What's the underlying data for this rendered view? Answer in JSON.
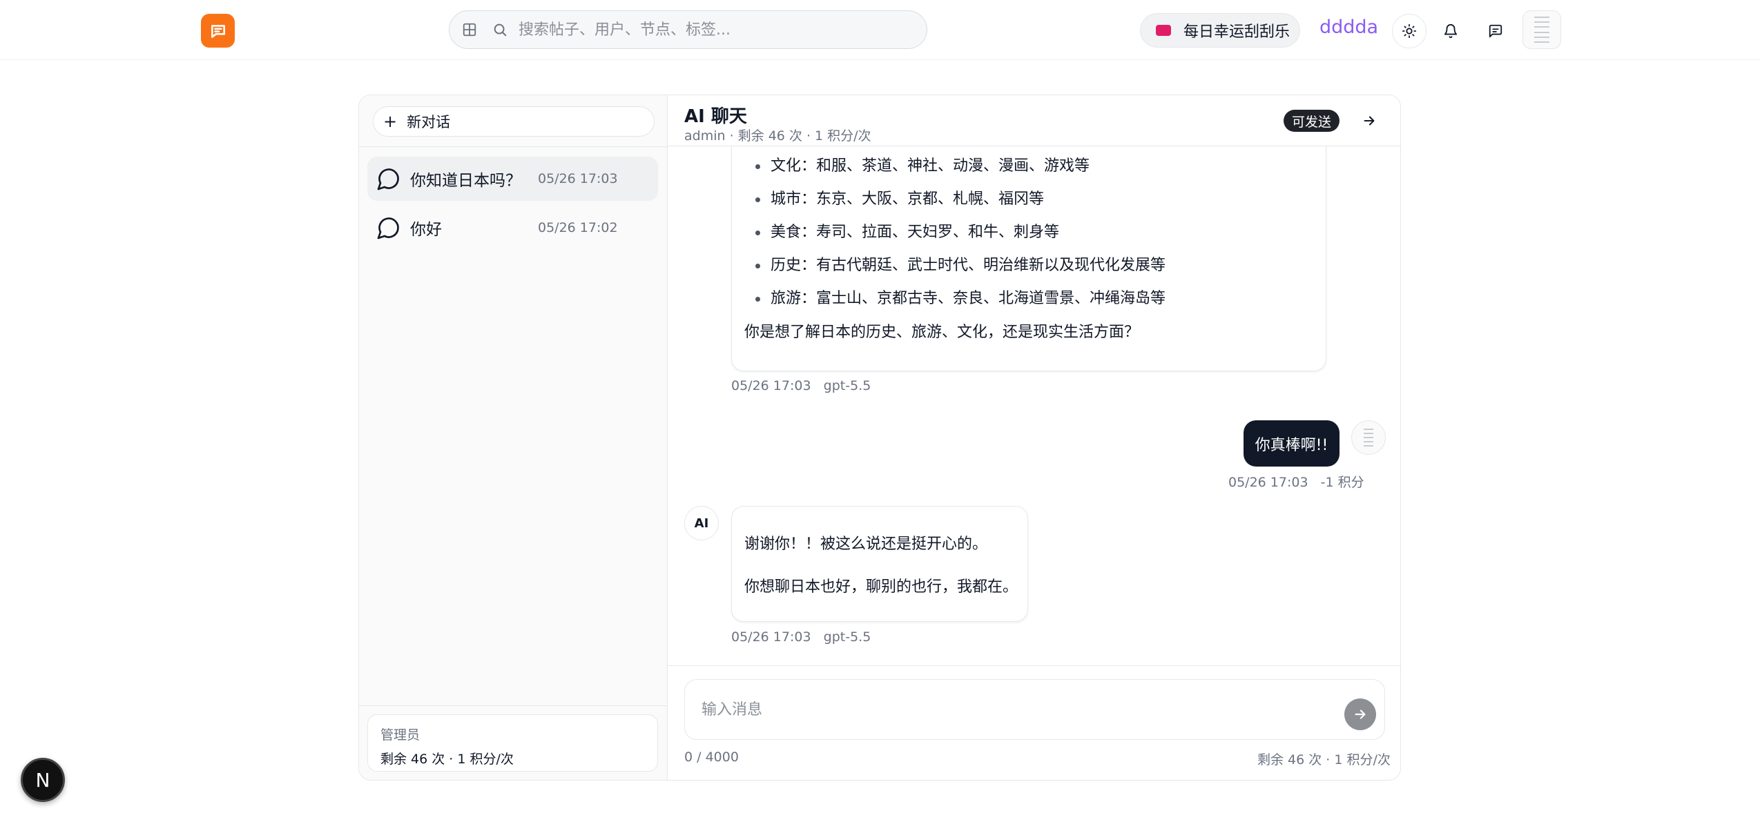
{
  "header": {
    "search_placeholder": "搜索帖子、用户、节点、标签...",
    "lucky_label": "每日幸运刮刮乐",
    "username": "dddda",
    "colors": {
      "logo": "#f97316",
      "username": "#8b5cf6",
      "lucky_ticket": "#e11d67"
    }
  },
  "sidebar": {
    "new_chat_label": "新对话",
    "conversations": [
      {
        "title": "你知道日本吗？",
        "time": "05/26 17:03",
        "active": true
      },
      {
        "title": "你好",
        "time": "05/26 17:02",
        "active": false
      }
    ],
    "footer": {
      "role": "管理员",
      "quota": "剩余 46 次 · 1 积分/次"
    }
  },
  "chat": {
    "title": "AI 聊天",
    "subtitle": "admin · 剩余 46 次 · 1 积分/次",
    "sendable_badge": "可发送",
    "messages": {
      "ai_1": {
        "bullets": [
          "文化：和服、茶道、神社、动漫、漫画、游戏等",
          "城市：东京、大阪、京都、札幌、福冈等",
          "美食：寿司、拉面、天妇罗、和牛、刺身等",
          "历史：有古代朝廷、武士时代、明治维新以及现代化发展等",
          "旅游：富士山、京都古寺、奈良、北海道雪景、冲绳海岛等"
        ],
        "question": "你是想了解日本的历史、旅游、文化，还是现实生活方面？",
        "meta": "05/26 17:03   gpt-5.5"
      },
      "user_1": {
        "text": "你真棒啊!!",
        "meta": "05/26 17:03   -1 积分"
      },
      "ai_2": {
        "avatar": "AI",
        "p1": "谢谢你！！被这么说还是挺开心的。",
        "p2": "你想聊日本也好，聊别的也行，我都在。",
        "meta": "05/26 17:03   gpt-5.5"
      }
    },
    "input": {
      "placeholder": "输入消息",
      "counter": "0 / 4000",
      "quota": "剩余 46 次 · 1 积分/次"
    }
  },
  "floating_badge": "N"
}
